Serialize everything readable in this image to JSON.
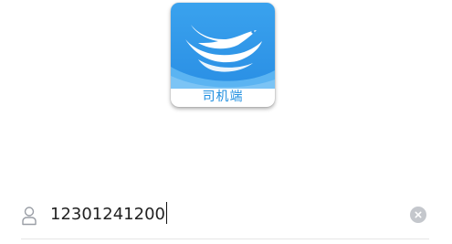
{
  "app": {
    "icon_name": "bird-logo-icon",
    "caption": "司机端",
    "brand_color": "#2f95e8",
    "caption_color": "#1f8fe0"
  },
  "login": {
    "phone": {
      "value": "12301241200",
      "leading_icon": "user-icon",
      "trailing_icon": "clear-icon"
    }
  }
}
